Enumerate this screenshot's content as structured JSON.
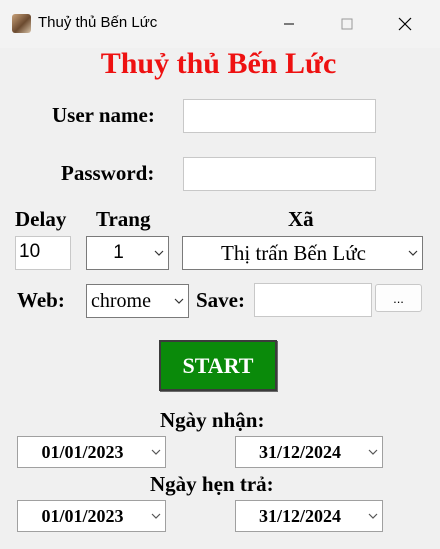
{
  "window": {
    "title": "Thuỷ thủ Bến Lức"
  },
  "heading": "Thuỷ thủ Bến Lức",
  "login": {
    "username_label": "User name:",
    "username_value": "",
    "password_label": "Password:",
    "password_value": ""
  },
  "settings": {
    "delay_label": "Delay",
    "delay_value": "10",
    "page_label": "Trang",
    "page_value": "1",
    "commune_label": "Xã",
    "commune_value": "Thị trấn Bến Lức",
    "web_label": "Web:",
    "web_value": "chrome",
    "save_label": "Save:",
    "save_value": "",
    "browse_label": "..."
  },
  "start_label": "START",
  "dates": {
    "received_label": "Ngày nhận:",
    "received_from": "01/01/2023",
    "received_to": "31/12/2024",
    "due_label": "Ngày hẹn trả:",
    "due_from": "01/01/2023",
    "due_to": "31/12/2024"
  }
}
